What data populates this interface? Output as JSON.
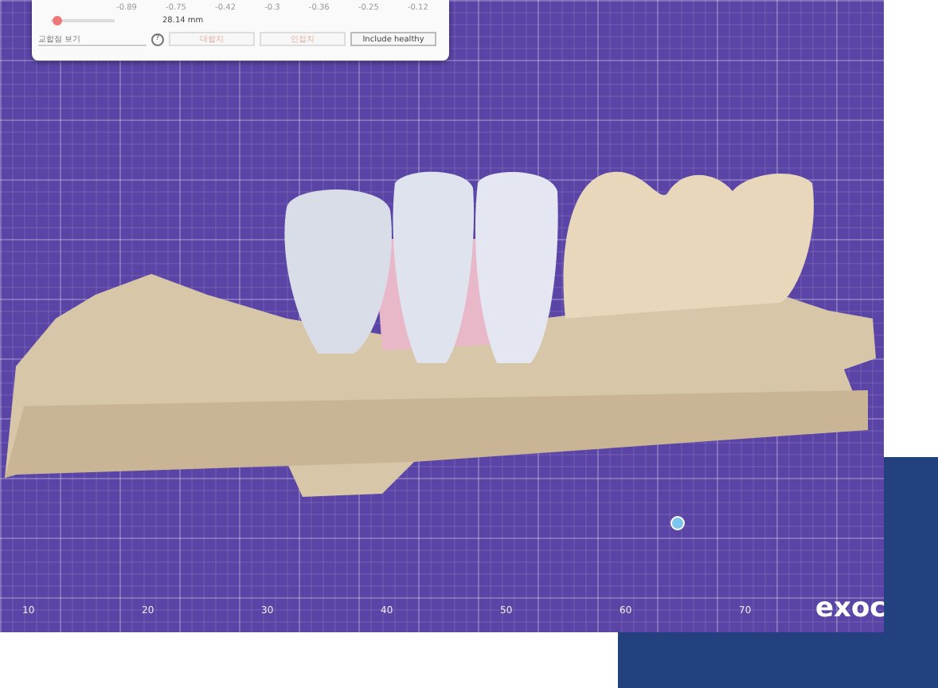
{
  "panel": {
    "scale_labels": [
      "-0.89",
      "-0.75",
      "-0.42",
      "-0.3",
      "-0.36",
      "-0.25",
      "-0.12"
    ],
    "slider": {
      "level": 0.1,
      "reading": "28.14 mm"
    },
    "view_dropdown": {
      "value": "교합점 보기"
    },
    "help": "?",
    "buttons": [
      {
        "label": "대합치",
        "disabled": true
      },
      {
        "label": "인접치",
        "disabled": true
      },
      {
        "label": "Include healthy",
        "disabled": false
      }
    ]
  },
  "ruler": {
    "labels": [
      "10",
      "20",
      "30",
      "40",
      "50",
      "60",
      "70"
    ]
  },
  "logo": "exoc"
}
